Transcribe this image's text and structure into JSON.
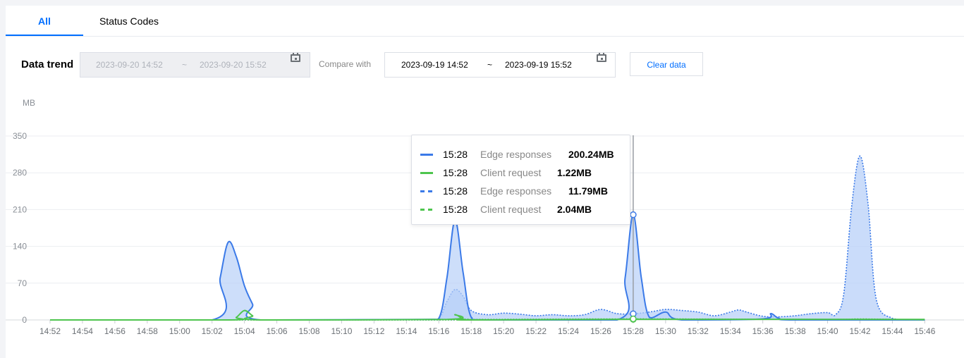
{
  "tabs": [
    {
      "label": "All",
      "active": true
    },
    {
      "label": "Status Codes",
      "active": false
    }
  ],
  "toolbar": {
    "title": "Data trend",
    "current_range": {
      "start": "2023-09-20 14:52",
      "separator": "~",
      "end": "2023-09-20 15:52",
      "disabled": true
    },
    "compare_label": "Compare with",
    "compare_range": {
      "start": "2023-09-19 14:52",
      "separator": "~",
      "end": "2023-09-19 15:52"
    },
    "clear_label": "Clear data",
    "calendar_icon": "calendar-icon"
  },
  "colors": {
    "accent": "#006eff",
    "edge": "#3b7ae8",
    "edge_fill": "#b8d0f8",
    "client": "#4ec54e",
    "grid": "#eceef1"
  },
  "tooltip": {
    "rows": [
      {
        "time": "15:28",
        "name": "Edge responses",
        "value": "200.24MB",
        "color": "#3b7ae8",
        "dashed": false
      },
      {
        "time": "15:28",
        "name": "Client request",
        "value": "1.22MB",
        "color": "#4ec54e",
        "dashed": false
      },
      {
        "time": "15:28",
        "name": "Edge responses",
        "value": "11.79MB",
        "color": "#3b7ae8",
        "dashed": true
      },
      {
        "time": "15:28",
        "name": "Client request",
        "value": "2.04MB",
        "color": "#4ec54e",
        "dashed": true
      }
    ]
  },
  "chart_data": {
    "type": "area",
    "ylabel": "MB",
    "ylim": [
      0,
      350
    ],
    "yticks": [
      0,
      70,
      140,
      210,
      280,
      350
    ],
    "xticks": [
      "14:52",
      "14:54",
      "14:56",
      "14:58",
      "15:00",
      "15:02",
      "15:04",
      "15:06",
      "15:08",
      "15:10",
      "15:12",
      "15:14",
      "15:16",
      "15:18",
      "15:20",
      "15:22",
      "15:24",
      "15:26",
      "15:28",
      "15:30",
      "15:32",
      "15:34",
      "15:36",
      "15:38",
      "15:40",
      "15:42",
      "15:44",
      "15:46"
    ],
    "grid": true,
    "hover_x": "15:28",
    "series": [
      {
        "name": "Edge responses",
        "style": "solid",
        "points": [
          [
            "14:52",
            0
          ],
          [
            "15:02",
            0
          ],
          [
            "15:02.5",
            80
          ],
          [
            "15:03",
            148
          ],
          [
            "15:03.5",
            120
          ],
          [
            "15:04",
            65
          ],
          [
            "15:04.5",
            30
          ],
          [
            "15:05",
            0
          ],
          [
            "15:15",
            1
          ],
          [
            "15:16",
            3
          ],
          [
            "15:16.5",
            80
          ],
          [
            "15:17",
            190
          ],
          [
            "15:17.5",
            90
          ],
          [
            "15:18",
            5
          ],
          [
            "15:19",
            0
          ],
          [
            "15:27",
            0
          ],
          [
            "15:27.5",
            80
          ],
          [
            "15:28",
            200.24
          ],
          [
            "15:28.5",
            80
          ],
          [
            "15:29",
            5
          ],
          [
            "15:30",
            15
          ],
          [
            "15:31",
            0
          ],
          [
            "15:36",
            2
          ],
          [
            "15:36.5",
            12
          ],
          [
            "15:37",
            3
          ],
          [
            "15:38",
            0
          ],
          [
            "15:46",
            0
          ]
        ]
      },
      {
        "name": "Client request",
        "style": "solid",
        "points": [
          [
            "14:52",
            0
          ],
          [
            "15:03",
            0
          ],
          [
            "15:03.5",
            5
          ],
          [
            "15:04",
            18
          ],
          [
            "15:04.5",
            8
          ],
          [
            "15:05",
            0
          ],
          [
            "15:16.5",
            1
          ],
          [
            "15:17",
            10
          ],
          [
            "15:17.5",
            2
          ],
          [
            "15:18",
            0
          ],
          [
            "15:28",
            1.22
          ],
          [
            "15:46",
            1
          ]
        ]
      },
      {
        "name": "Edge responses",
        "style": "dashed",
        "points": [
          [
            "14:52",
            0
          ],
          [
            "15:15",
            0
          ],
          [
            "15:16",
            3
          ],
          [
            "15:16.5",
            35
          ],
          [
            "15:17",
            58
          ],
          [
            "15:17.5",
            45
          ],
          [
            "15:18",
            18
          ],
          [
            "15:19",
            10
          ],
          [
            "15:20",
            13
          ],
          [
            "15:21",
            11
          ],
          [
            "15:22",
            8
          ],
          [
            "15:23",
            10
          ],
          [
            "15:24",
            8
          ],
          [
            "15:25",
            10
          ],
          [
            "15:26",
            20
          ],
          [
            "15:27",
            12
          ],
          [
            "15:28",
            11.79
          ],
          [
            "15:29",
            15
          ],
          [
            "15:30",
            20
          ],
          [
            "15:31",
            18
          ],
          [
            "15:32",
            15
          ],
          [
            "15:33",
            8
          ],
          [
            "15:34",
            15
          ],
          [
            "15:34.5",
            19
          ],
          [
            "15:35",
            15
          ],
          [
            "15:36",
            7
          ],
          [
            "15:37",
            6
          ],
          [
            "15:38",
            8
          ],
          [
            "15:39",
            12
          ],
          [
            "15:40",
            14
          ],
          [
            "15:40.5",
            10
          ],
          [
            "15:41",
            50
          ],
          [
            "15:41.5",
            220
          ],
          [
            "15:42",
            312
          ],
          [
            "15:42.5",
            220
          ],
          [
            "15:43",
            40
          ],
          [
            "15:44",
            3
          ],
          [
            "15:45",
            0
          ],
          [
            "15:46",
            0
          ]
        ]
      },
      {
        "name": "Client request",
        "style": "dashed",
        "points": [
          [
            "14:52",
            0
          ],
          [
            "15:16",
            0
          ],
          [
            "15:17",
            2
          ],
          [
            "15:18",
            1
          ],
          [
            "15:28",
            2.04
          ],
          [
            "15:40",
            1
          ],
          [
            "15:42",
            2
          ],
          [
            "15:46",
            0
          ]
        ]
      }
    ]
  }
}
